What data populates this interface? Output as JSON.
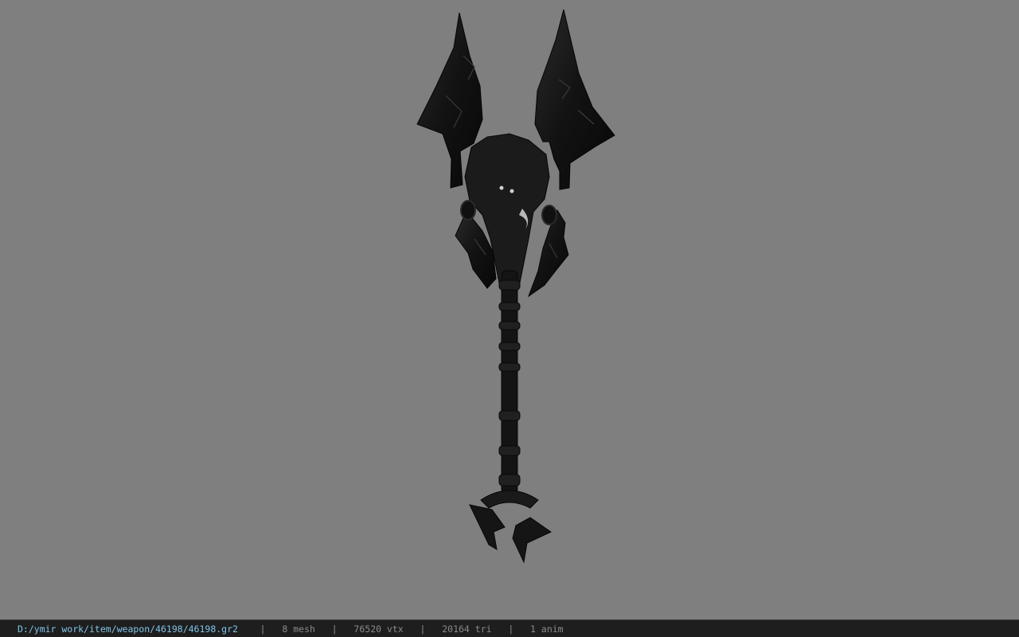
{
  "viewport": {
    "background_color": "#7f7f7f",
    "model": {
      "object": "dark ornate winged axe weapon",
      "color": "#141414"
    }
  },
  "statusbar": {
    "file_path": "D:/ymir work/item/weapon/46198/46198.gr2",
    "separator": "|",
    "mesh_count": "8 mesh",
    "vertex_count": "76520 vtx",
    "triangle_count": "20164 tri",
    "anim_count": "1 anim",
    "path_color": "#7fc4e8",
    "text_color": "#8a8a8a",
    "background_color": "#1e1e1e"
  }
}
